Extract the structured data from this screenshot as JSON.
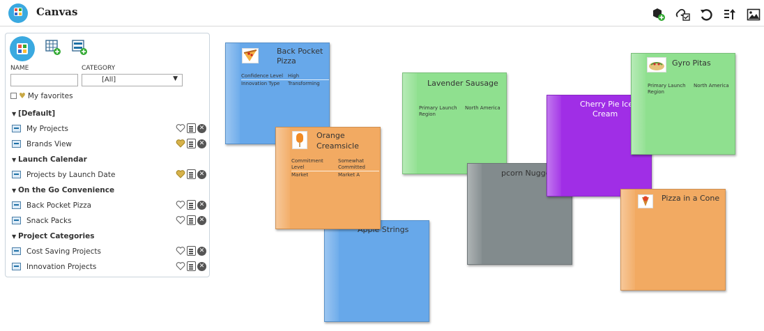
{
  "header": {
    "title": "Canvas"
  },
  "toolbar": {
    "icons": [
      "add-hexagon-icon",
      "link-check-icon",
      "refresh-icon",
      "sort-icon",
      "image-icon"
    ]
  },
  "sidebar": {
    "name_label": "NAME",
    "category_label": "CATEGORY",
    "category_value": "[All]",
    "name_value": "",
    "favorites_label": "My favorites",
    "tree": [
      {
        "type": "group",
        "label": "[Default]"
      },
      {
        "type": "item",
        "label": "My Projects",
        "fav": false
      },
      {
        "type": "item",
        "label": "Brands View",
        "fav": true
      },
      {
        "type": "group",
        "label": "Launch Calendar"
      },
      {
        "type": "item",
        "label": "Projects by Launch Date",
        "fav": true
      },
      {
        "type": "group",
        "label": "On the Go Convenience"
      },
      {
        "type": "item",
        "label": "Back Pocket Pizza",
        "fav": false
      },
      {
        "type": "item",
        "label": "Snack Packs",
        "fav": false
      },
      {
        "type": "group",
        "label": "Project Categories"
      },
      {
        "type": "item",
        "label": "Cost Saving Projects",
        "fav": false
      },
      {
        "type": "item",
        "label": "Innovation Projects",
        "fav": false
      }
    ]
  },
  "cards": {
    "back_pocket": {
      "title_line1": "Back Pocket",
      "title_line2": "Pizza",
      "f1_label": "Confidence Level",
      "f1_value": "High",
      "f2_label": "Innovation Type",
      "f2_value": "Transforming",
      "color": "#67a8ea"
    },
    "orange": {
      "title_line1": "Orange",
      "title_line2": "Creamsicle",
      "f1_label_1": "Commitment",
      "f1_label_2": "Level",
      "f1_value_1": "Somewhat",
      "f1_value_2": "Committed",
      "f2_label": "Market",
      "f2_value": "Market A",
      "color": "#f2aa62"
    },
    "apple": {
      "title": "Apple Strings",
      "color": "#67a8ea"
    },
    "lavender": {
      "title": "Lavender Sausage",
      "f1_label_1": "Primary Launch",
      "f1_label_2": "Region",
      "f1_value": "North America",
      "color": "#8fe08f"
    },
    "popcorn": {
      "title": "pcorn Nuggets",
      "color": "#828b8d"
    },
    "cherry": {
      "title_line1": "Cherry Pie Ice",
      "title_line2": "Cream",
      "color": "#a02ee6"
    },
    "gyro": {
      "title": "Gyro Pitas",
      "f1_label_1": "Primary Launch",
      "f1_label_2": "Region",
      "f1_value": "North America",
      "color": "#8fe08f"
    },
    "cone": {
      "title": "Pizza in a Cone",
      "color": "#f2aa62"
    }
  }
}
